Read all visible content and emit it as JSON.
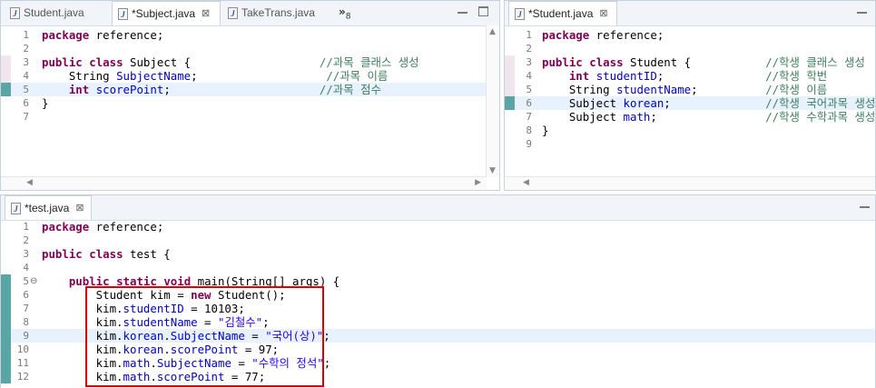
{
  "top_left_pane": {
    "tabs": [
      {
        "label": "Student.java",
        "active": false,
        "closable": false
      },
      {
        "label": "*Subject.java",
        "active": true,
        "closable": true
      },
      {
        "label": "TakeTrans.java",
        "active": false,
        "closable": false
      }
    ],
    "overflow_count": "8",
    "lines": [
      {
        "n": "1",
        "code": [
          {
            "t": "kw",
            "v": "package"
          },
          {
            "t": "p",
            "v": " reference;"
          }
        ]
      },
      {
        "n": "2",
        "code": []
      },
      {
        "n": "3",
        "code": [
          {
            "t": "kw",
            "v": "public"
          },
          {
            "t": "p",
            "v": " "
          },
          {
            "t": "kw",
            "v": "class"
          },
          {
            "t": "p",
            "v": " Subject {                   "
          },
          {
            "t": "cmt",
            "v": "//과목 클래스 생성"
          }
        ]
      },
      {
        "n": "4",
        "code": [
          {
            "t": "p",
            "v": "    String "
          },
          {
            "t": "fld",
            "v": "SubjectName"
          },
          {
            "t": "p",
            "v": ";                   "
          },
          {
            "t": "cmt",
            "v": "//과목 이름"
          }
        ]
      },
      {
        "n": "5",
        "code": [
          {
            "t": "p",
            "v": "    "
          },
          {
            "t": "kw",
            "v": "int"
          },
          {
            "t": "p",
            "v": " "
          },
          {
            "t": "fld",
            "v": "scorePoint"
          },
          {
            "t": "p",
            "v": ";                      "
          },
          {
            "t": "cmt",
            "v": "//과목 점수"
          }
        ],
        "hl": true
      },
      {
        "n": "6",
        "code": [
          {
            "t": "p",
            "v": "}"
          }
        ]
      },
      {
        "n": "7",
        "code": []
      }
    ]
  },
  "top_right_pane": {
    "tabs": [
      {
        "label": "*Student.java",
        "active": true,
        "closable": true
      }
    ],
    "lines": [
      {
        "n": "1",
        "code": [
          {
            "t": "kw",
            "v": "package"
          },
          {
            "t": "p",
            "v": " reference;"
          }
        ]
      },
      {
        "n": "2",
        "code": []
      },
      {
        "n": "3",
        "code": [
          {
            "t": "kw",
            "v": "public"
          },
          {
            "t": "p",
            "v": " "
          },
          {
            "t": "kw",
            "v": "class"
          },
          {
            "t": "p",
            "v": " Student {           "
          },
          {
            "t": "cmt",
            "v": "//학생 클래스 생성"
          }
        ]
      },
      {
        "n": "4",
        "code": [
          {
            "t": "p",
            "v": "    "
          },
          {
            "t": "kw",
            "v": "int"
          },
          {
            "t": "p",
            "v": " "
          },
          {
            "t": "fld",
            "v": "studentID"
          },
          {
            "t": "p",
            "v": ";               "
          },
          {
            "t": "cmt",
            "v": "//학생 학번"
          }
        ]
      },
      {
        "n": "5",
        "code": [
          {
            "t": "p",
            "v": "    String "
          },
          {
            "t": "fld",
            "v": "studentName"
          },
          {
            "t": "p",
            "v": ";          "
          },
          {
            "t": "cmt",
            "v": "//학생 이름"
          }
        ]
      },
      {
        "n": "6",
        "code": [
          {
            "t": "p",
            "v": "    Subject "
          },
          {
            "t": "fld",
            "v": "korean"
          },
          {
            "t": "p",
            "v": ";              "
          },
          {
            "t": "cmt",
            "v": "//학생 국어과목 생성"
          }
        ],
        "hl": true
      },
      {
        "n": "7",
        "code": [
          {
            "t": "p",
            "v": "    Subject "
          },
          {
            "t": "fld",
            "v": "math"
          },
          {
            "t": "p",
            "v": ";                "
          },
          {
            "t": "cmt",
            "v": "//학생 수학과목 생성"
          }
        ]
      },
      {
        "n": "8",
        "code": [
          {
            "t": "p",
            "v": "}"
          }
        ]
      },
      {
        "n": "9",
        "code": []
      }
    ]
  },
  "bottom_pane": {
    "tabs": [
      {
        "label": "*test.java",
        "active": true,
        "closable": true
      }
    ],
    "lines": [
      {
        "n": "1",
        "code": [
          {
            "t": "kw",
            "v": "package"
          },
          {
            "t": "p",
            "v": " reference;"
          }
        ]
      },
      {
        "n": "2",
        "code": []
      },
      {
        "n": "3",
        "code": [
          {
            "t": "kw",
            "v": "public"
          },
          {
            "t": "p",
            "v": " "
          },
          {
            "t": "kw",
            "v": "class"
          },
          {
            "t": "p",
            "v": " test {"
          }
        ]
      },
      {
        "n": "4",
        "code": []
      },
      {
        "n": "5",
        "code": [
          {
            "t": "p",
            "v": "    "
          },
          {
            "t": "kw",
            "v": "public"
          },
          {
            "t": "p",
            "v": " "
          },
          {
            "t": "kw",
            "v": "static"
          },
          {
            "t": "p",
            "v": " "
          },
          {
            "t": "kw",
            "v": "void"
          },
          {
            "t": "p",
            "v": " main(String[] args) {"
          }
        ],
        "fold": "⊖"
      },
      {
        "n": "6",
        "code": [
          {
            "t": "p",
            "v": "        Student kim = "
          },
          {
            "t": "kw",
            "v": "new"
          },
          {
            "t": "p",
            "v": " Student();"
          }
        ]
      },
      {
        "n": "7",
        "code": [
          {
            "t": "p",
            "v": "        kim."
          },
          {
            "t": "fld",
            "v": "studentID"
          },
          {
            "t": "p",
            "v": " = 10103;"
          }
        ]
      },
      {
        "n": "8",
        "code": [
          {
            "t": "p",
            "v": "        kim."
          },
          {
            "t": "fld",
            "v": "studentName"
          },
          {
            "t": "p",
            "v": " = "
          },
          {
            "t": "str",
            "v": "\"김철수\""
          },
          {
            "t": "p",
            "v": ";"
          }
        ]
      },
      {
        "n": "9",
        "code": [
          {
            "t": "p",
            "v": "        kim."
          },
          {
            "t": "fld",
            "v": "korean"
          },
          {
            "t": "p",
            "v": "."
          },
          {
            "t": "fld",
            "v": "SubjectName"
          },
          {
            "t": "p",
            "v": " = "
          },
          {
            "t": "str",
            "v": "\"국어(상)\""
          },
          {
            "t": "p",
            "v": ";"
          }
        ],
        "hl": true
      },
      {
        "n": "10",
        "code": [
          {
            "t": "p",
            "v": "        kim."
          },
          {
            "t": "fld",
            "v": "korean"
          },
          {
            "t": "p",
            "v": "."
          },
          {
            "t": "fld",
            "v": "scorePoint"
          },
          {
            "t": "p",
            "v": " = 97;"
          }
        ]
      },
      {
        "n": "11",
        "code": [
          {
            "t": "p",
            "v": "        kim."
          },
          {
            "t": "fld",
            "v": "math"
          },
          {
            "t": "p",
            "v": "."
          },
          {
            "t": "fld",
            "v": "SubjectName"
          },
          {
            "t": "p",
            "v": " = "
          },
          {
            "t": "str",
            "v": "\"수학의 정석\""
          },
          {
            "t": "p",
            "v": ";"
          }
        ]
      },
      {
        "n": "12",
        "code": [
          {
            "t": "p",
            "v": "        kim."
          },
          {
            "t": "fld",
            "v": "math"
          },
          {
            "t": "p",
            "v": "."
          },
          {
            "t": "fld",
            "v": "scorePoint"
          },
          {
            "t": "p",
            "v": " = 77;"
          }
        ]
      }
    ]
  },
  "colors": {
    "keyword": "#7f0055",
    "field": "#0000c0",
    "string": "#2a00ff",
    "comment": "#3f7f5f",
    "highlight": "#e8f2fe",
    "selection_box": "#e00000"
  },
  "icons": {
    "java_file": "java-file-icon",
    "close": "close-icon",
    "overflow": "chevron-double-right-icon"
  }
}
